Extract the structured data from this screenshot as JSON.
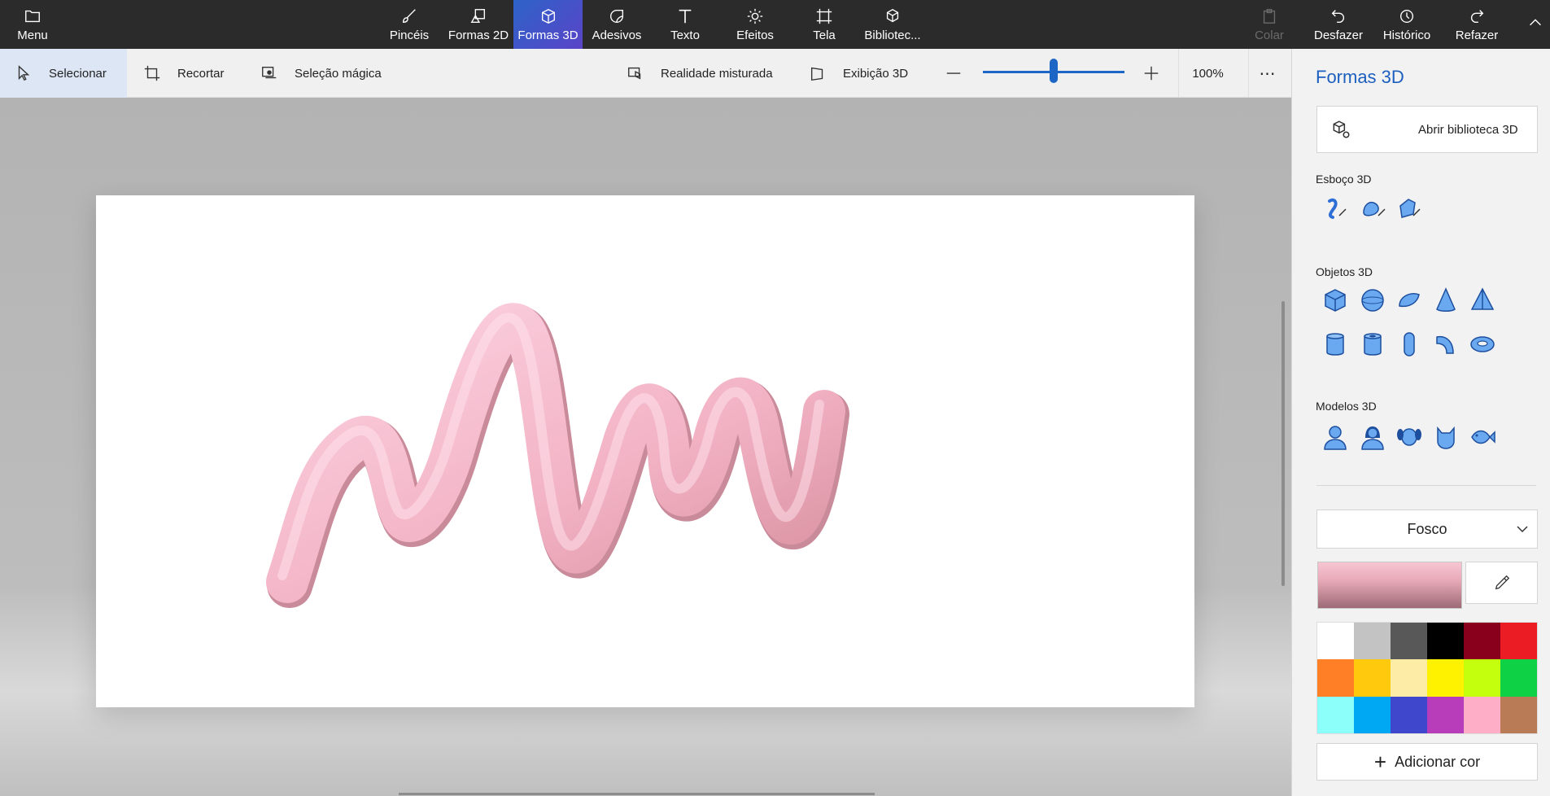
{
  "topbar": {
    "menu_label": "Menu",
    "tools": [
      {
        "label": "Pincéis",
        "icon": "brush-icon"
      },
      {
        "label": "Formas 2D",
        "icon": "shapes-2d-icon"
      },
      {
        "label": "Formas 3D",
        "icon": "cube-icon",
        "active": true
      },
      {
        "label": "Adesivos",
        "icon": "sticker-icon"
      },
      {
        "label": "Texto",
        "icon": "text-icon"
      },
      {
        "label": "Efeitos",
        "icon": "sun-icon"
      },
      {
        "label": "Tela",
        "icon": "canvas-icon"
      },
      {
        "label": "Bibliotec...",
        "icon": "library-icon"
      }
    ],
    "paste_label": "Colar",
    "undo_label": "Desfazer",
    "history_label": "Histórico",
    "redo_label": "Refazer"
  },
  "toolbar": {
    "select_label": "Selecionar",
    "crop_label": "Recortar",
    "magic_select_label": "Seleção mágica",
    "mixed_reality_label": "Realidade misturada",
    "view3d_label": "Exibição 3D",
    "zoom_value": "100%",
    "zoom_fraction": 0.5
  },
  "panel": {
    "title": "Formas 3D",
    "open_library_label": "Abrir biblioteca 3D",
    "sketch_label": "Esboço 3D",
    "objects_label": "Objetos 3D",
    "models_label": "Modelos 3D",
    "material_label": "Fosco",
    "add_color_label": "Adicionar cor",
    "palette": [
      "#ffffff",
      "#c3c3c3",
      "#585858",
      "#000000",
      "#88001b",
      "#ec1c24",
      "#ff7f27",
      "#ffc90e",
      "#fdeca6",
      "#fff200",
      "#c4ff0e",
      "#0ed145",
      "#8cfffb",
      "#00a8f3",
      "#3f48cc",
      "#b83dba",
      "#ffaec8",
      "#b97a56"
    ]
  },
  "colors": {
    "accent": "#1d5fbf",
    "stroke": "#f2b6c6",
    "topbar_bg": "#2b2b2b"
  }
}
